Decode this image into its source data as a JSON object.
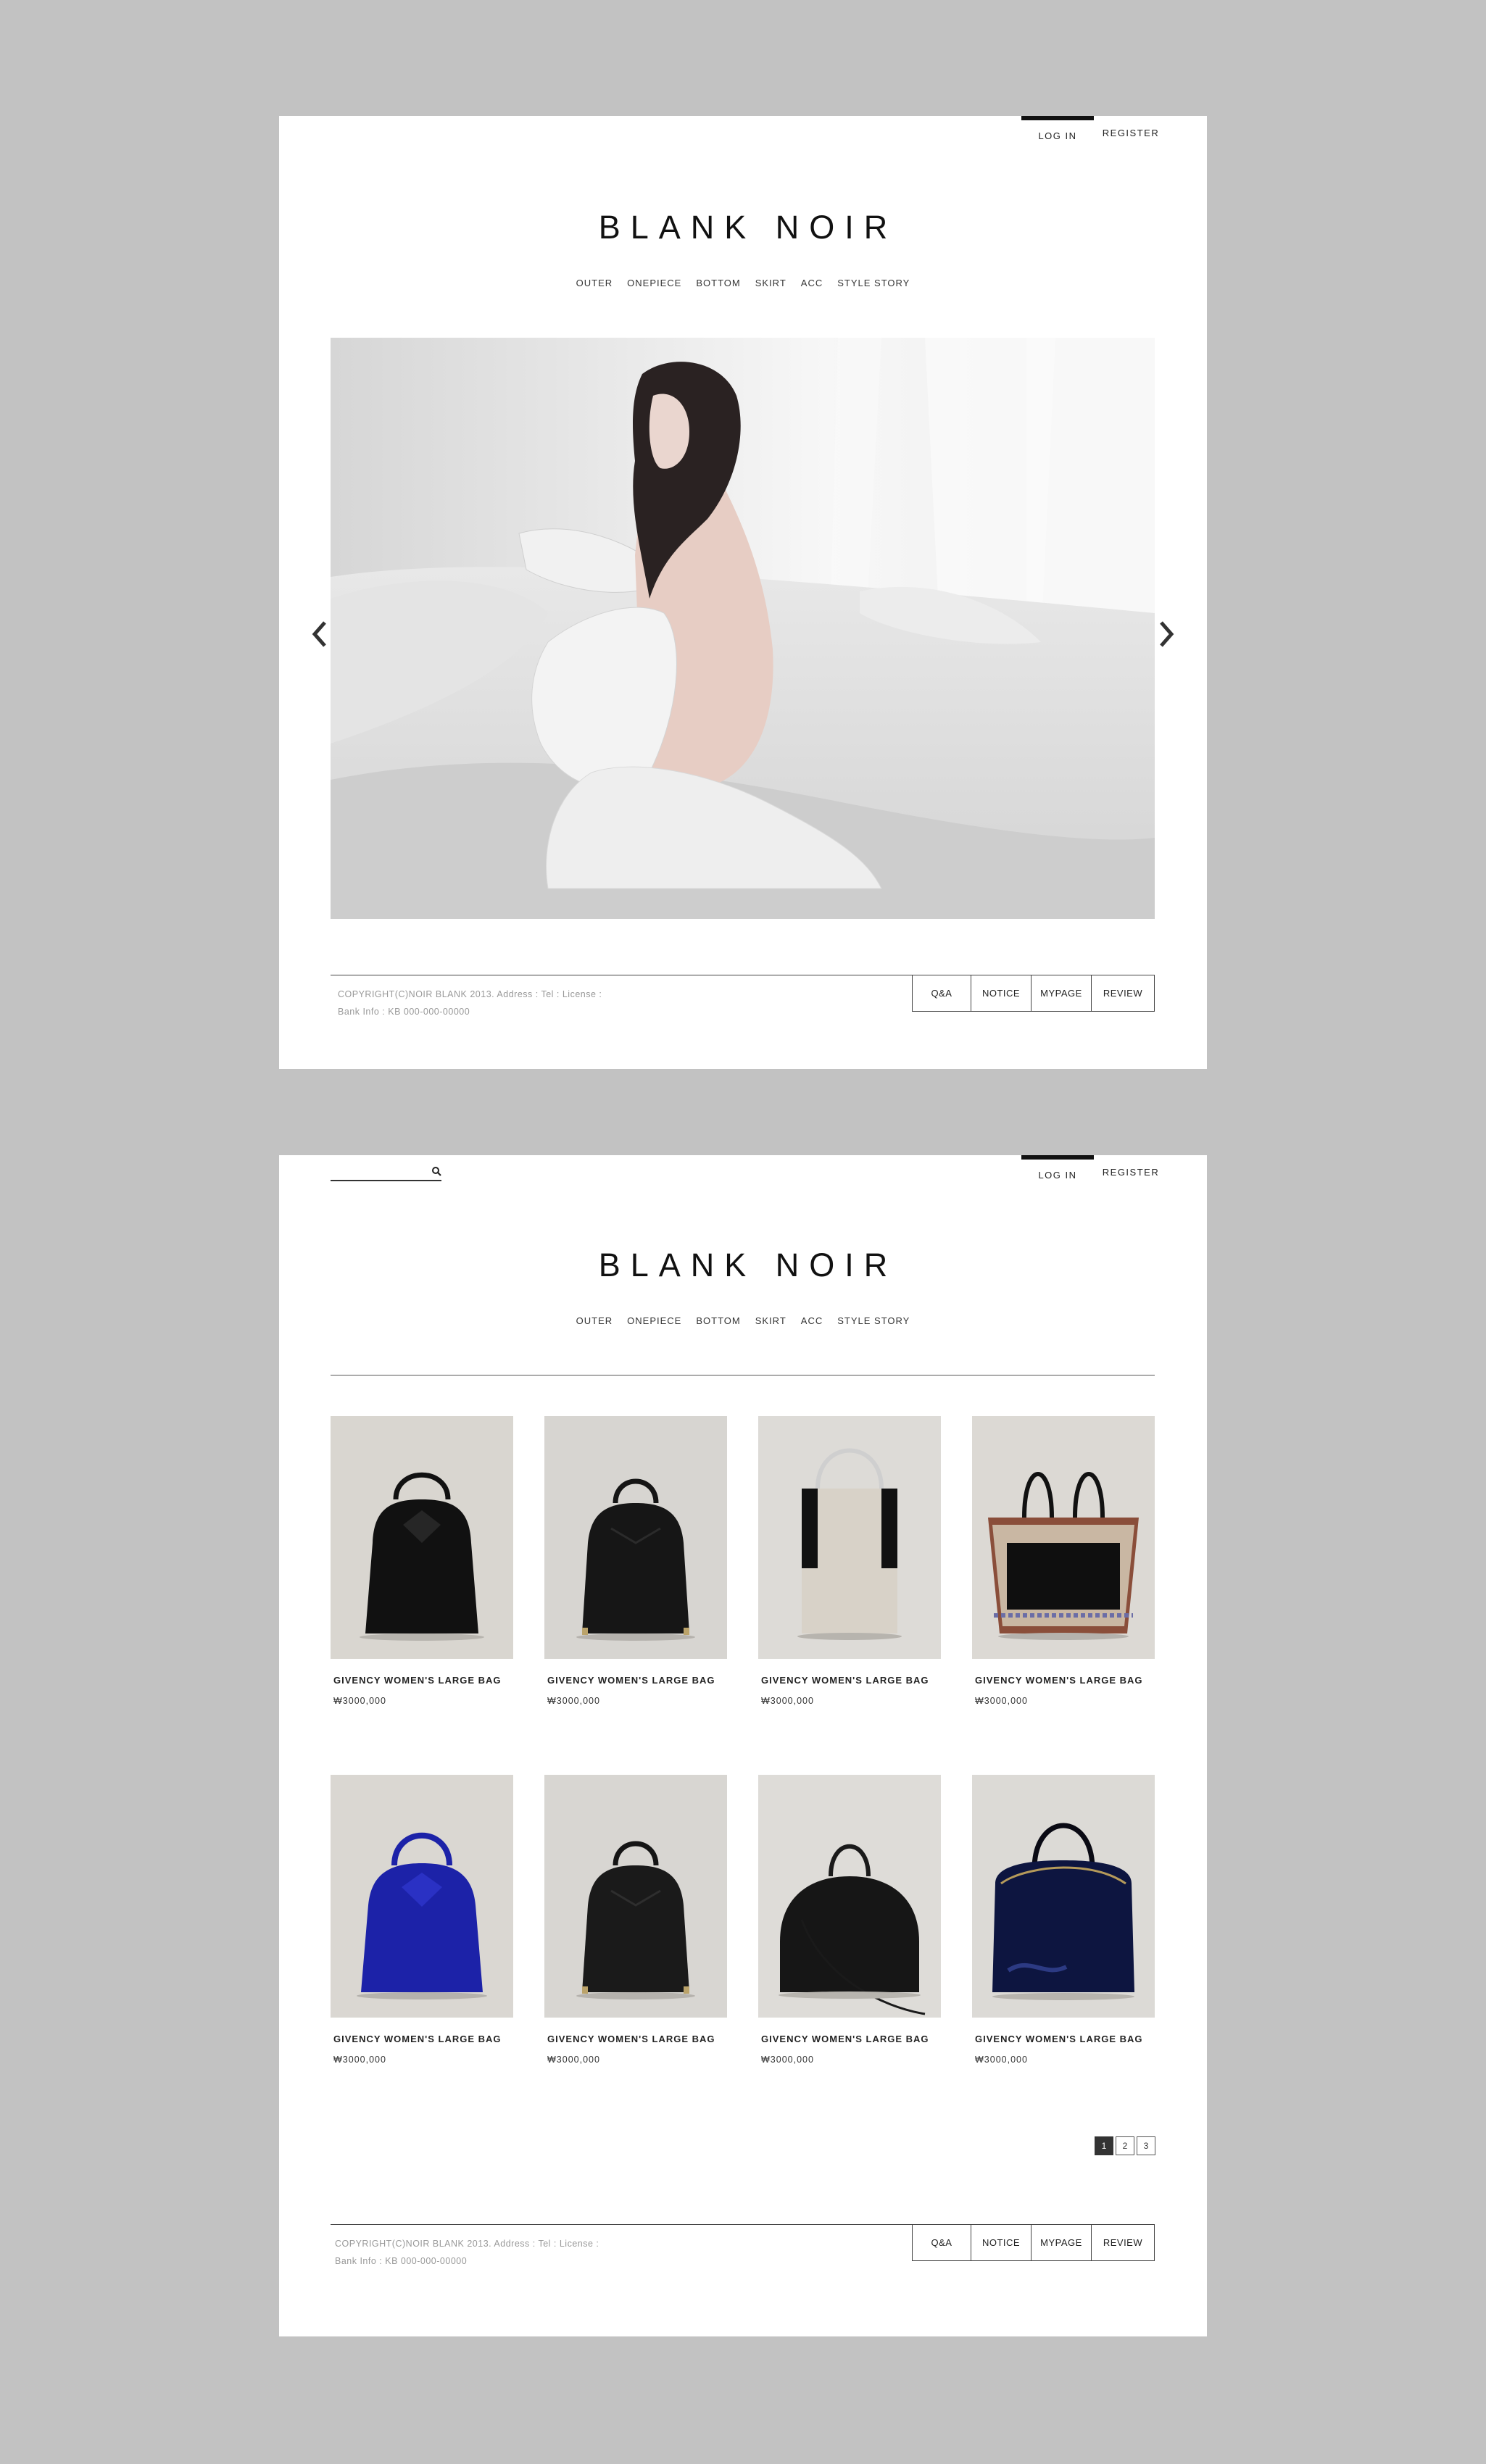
{
  "header": {
    "login": "LOG IN",
    "register": "REGISTER",
    "logo": "BLANK NOIR",
    "nav": [
      "OUTER",
      "ONEPIECE",
      "BOTTOM",
      "SKIRT",
      "ACC",
      "STYLE STORY"
    ]
  },
  "footer": {
    "copyright": "COPYRIGHT(C)NOIR BLANK 2013. Address : Tel : License :",
    "bank": "Bank Info : KB 000-000-00000",
    "buttons": [
      "Q&A",
      "NOTICE",
      "MYPAGE",
      "REVIEW"
    ]
  },
  "search": {
    "placeholder": ""
  },
  "products": [
    {
      "name": "GIVENCY WOMEN'S LARGE BAG",
      "price": "₩3000,000"
    },
    {
      "name": "GIVENCY WOMEN'S LARGE BAG",
      "price": "₩3000,000"
    },
    {
      "name": "GIVENCY WOMEN'S LARGE BAG",
      "price": "₩3000,000"
    },
    {
      "name": "GIVENCY WOMEN'S LARGE BAG",
      "price": "₩3000,000"
    },
    {
      "name": "GIVENCY WOMEN'S LARGE BAG",
      "price": "₩3000,000"
    },
    {
      "name": "GIVENCY WOMEN'S LARGE BAG",
      "price": "₩3000,000"
    },
    {
      "name": "GIVENCY WOMEN'S LARGE BAG",
      "price": "₩3000,000"
    },
    {
      "name": "GIVENCY WOMEN'S LARGE BAG",
      "price": "₩3000,000"
    }
  ],
  "pagination": {
    "pages": [
      "1",
      "2",
      "3"
    ],
    "current": "1"
  },
  "colors": {
    "background": "#c2c2c2",
    "panel": "#ffffff",
    "text": "#222222",
    "accent": "#111111",
    "bag_blue": "#1c22a8",
    "bag_navy": "#0d1540"
  }
}
